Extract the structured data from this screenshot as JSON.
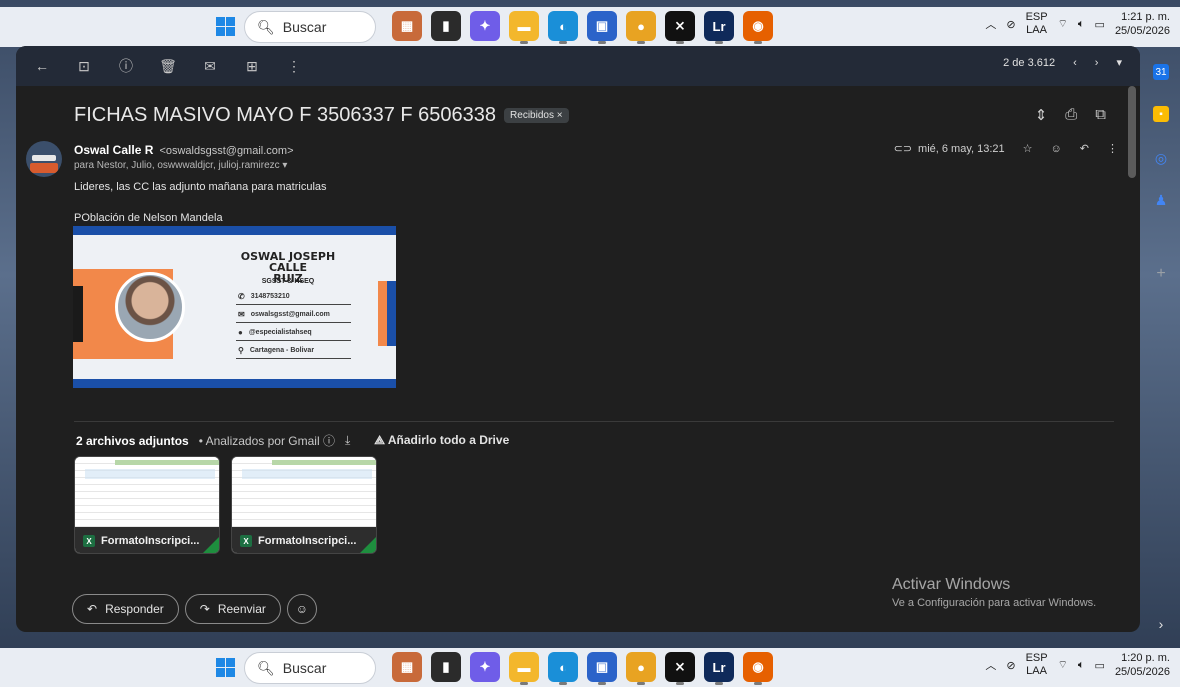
{
  "taskbar_top": {
    "search_placeholder": "Buscar",
    "lang1": "ESP",
    "lang2": "LAA",
    "time": "1:21 p. m.",
    "date": "25/05/2026"
  },
  "taskbar_bottom": {
    "search_placeholder": "Buscar",
    "lang1": "ESP",
    "lang2": "LAA",
    "time": "1:20 p. m.",
    "date": "25/05/2026"
  },
  "taskbar_apps": [
    {
      "icon": "news-weather-icon",
      "color": "#c86a3a",
      "glyph": "▦"
    },
    {
      "icon": "task-view-icon",
      "color": "#2b2b2b",
      "glyph": "▮"
    },
    {
      "icon": "copilot-icon",
      "color": "#6f5de8",
      "glyph": "✦"
    },
    {
      "icon": "file-explorer-icon",
      "color": "#f3b72c",
      "glyph": "▬"
    },
    {
      "icon": "edge-icon",
      "color": "#1a8fd8",
      "glyph": "◐"
    },
    {
      "icon": "store-icon",
      "color": "#2b63c9",
      "glyph": "▣"
    },
    {
      "icon": "chrome-icon",
      "color": "#e8a322",
      "glyph": "●"
    },
    {
      "icon": "capcut-icon",
      "color": "#111111",
      "glyph": "⨯"
    },
    {
      "icon": "lightroom-icon",
      "color": "#0f2a5a",
      "glyph": "Lr"
    },
    {
      "icon": "firefox-icon",
      "color": "#e66000",
      "glyph": "◉"
    }
  ],
  "pager": {
    "text": "2 de 3.612"
  },
  "email": {
    "subject": "FICHAS MASIVO MAYO F 3506337 F 6506338",
    "label": "Recibidos ×",
    "sender_name": "Oswal Calle R",
    "sender_email": "<oswaldsgsst@gmail.com>",
    "recipients": "para Nestor, Julio, oswwwaldjcr, julioj.ramirezc ▾",
    "date": "mié, 6 may, 13:21",
    "body_line1": "Lideres, las CC las adjunto mañana para matriculas",
    "body_line2": "POblación de Nelson Mandela"
  },
  "card": {
    "name_line1": "OSWAL JOSEPH CALLE",
    "name_line2": "RUIZ",
    "title": "SGSST & HSEQ",
    "phone": "3148753210",
    "email": "oswalsgsst@gmail.com",
    "social": "@especialistahseq",
    "location": "Cartagena - Bolivar"
  },
  "attachments": {
    "count_label": "2 archivos adjuntos",
    "scan_label": "• Analizados por Gmail ⓘ",
    "drive_label": "Añadirlo todo a Drive",
    "files": [
      {
        "name": "FormatoInscripci..."
      },
      {
        "name": "FormatoInscripci..."
      }
    ]
  },
  "reply": {
    "reply_label": "Responder",
    "forward_label": "Reenviar"
  },
  "watermark": {
    "line1": "Activar Windows",
    "line2": "Ve a Configuración para activar Windows."
  }
}
